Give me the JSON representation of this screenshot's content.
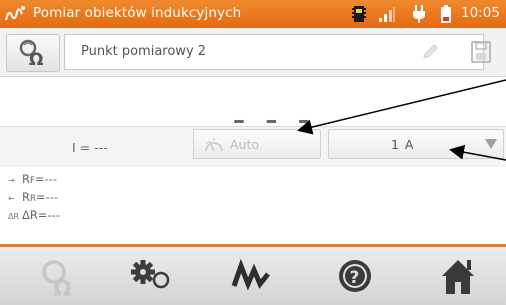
{
  "status_bar": {
    "title": "Pomiar obiektów indukcyjnych",
    "time": "10:05",
    "icons": [
      "app-logo-icon",
      "memory-card-icon",
      "signal-icon",
      "plug-icon",
      "battery-icon"
    ]
  },
  "point": {
    "name": "Punkt pomiarowy 2"
  },
  "measurement": {
    "main_value": "– – –",
    "current_label": "I = ---",
    "auto_label": "Auto",
    "range_value": "1 A"
  },
  "results": {
    "rf_symbol": "→",
    "rf_label": "R",
    "rf_sub": "F",
    "rf_value": "=---",
    "rr_symbol": "←",
    "rr_label": "R",
    "rr_sub": "R",
    "rr_value": "=---",
    "dr_symbol": "ΔR",
    "dr_label": "ΔR",
    "dr_value": "=---"
  },
  "bottom_nav": [
    "measurement-mode-icon",
    "settings-icon",
    "waveform-icon",
    "help-icon",
    "home-icon"
  ],
  "colors": {
    "accent": "#e8782a",
    "header": "#ec7a22"
  }
}
